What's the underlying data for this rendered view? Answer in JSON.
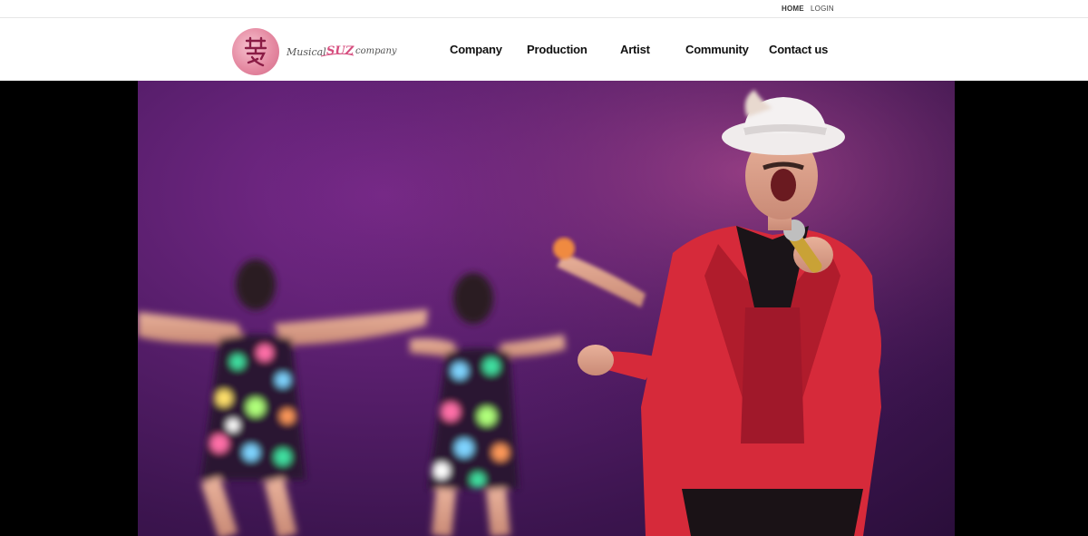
{
  "utility_bar": {
    "home_label": "HOME",
    "login_label": "LOGIN"
  },
  "header": {
    "logo_text": "MUSICAL SUZ COMPANY",
    "nav": [
      {
        "label": "Company"
      },
      {
        "label": "Production"
      },
      {
        "label": "Artist"
      },
      {
        "label": "Community"
      },
      {
        "label": "Contact us"
      }
    ]
  },
  "hero": {
    "image_alt": "performer singing on stage with dancers"
  },
  "colors": {
    "brand_pink": "#d64d7e",
    "stage_purple": "#5a1f6e",
    "jacket_red": "#d62a3a"
  }
}
